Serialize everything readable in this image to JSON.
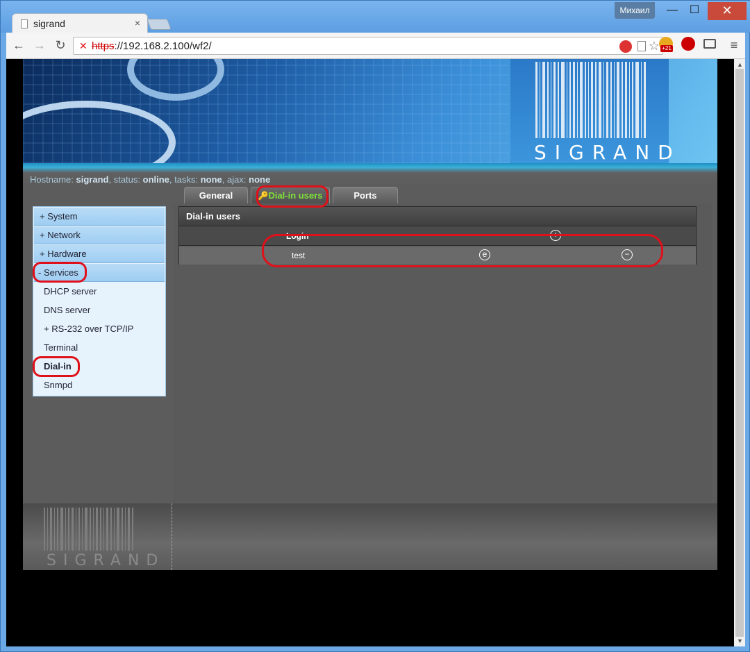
{
  "browser": {
    "tab_title": "sigrand",
    "tab_close": "×",
    "user_name": "Михаил",
    "window_min": "—",
    "window_max": "☐",
    "window_close": "✕",
    "back": "←",
    "forward": "→",
    "reload": "↻",
    "menu": "≡",
    "url_scheme": "https",
    "url_rest": "://192.168.2.100/wf2/",
    "ext_badge": "+21"
  },
  "banner": {
    "brand": "SIGRAND"
  },
  "status": {
    "hostname_label": "Hostname:",
    "hostname": "sigrand",
    "status_label": "status:",
    "status": "online",
    "tasks_label": "tasks:",
    "tasks": "none",
    "ajax_label": "ajax:",
    "ajax": "none"
  },
  "tabs": [
    {
      "label": "General"
    },
    {
      "label": "Dial-in users"
    },
    {
      "label": "Ports"
    }
  ],
  "sidebar": {
    "items": [
      {
        "label": "+ System"
      },
      {
        "label": "+ Network"
      },
      {
        "label": "+ Hardware"
      },
      {
        "label": "- Services"
      },
      {
        "label": "DHCP server"
      },
      {
        "label": "DNS server"
      },
      {
        "label": "+ RS-232 over TCP/IP"
      },
      {
        "label": "Terminal"
      },
      {
        "label": "Dial-in"
      },
      {
        "label": "Snmpd"
      }
    ]
  },
  "panel": {
    "title": "Dial-in users",
    "login_header": "Login",
    "add_symbol": "+",
    "rows": [
      {
        "login": "test",
        "edit_symbol": "e",
        "delete_symbol": "−"
      }
    ]
  },
  "footer": {
    "brand": "SIGRAND"
  },
  "colors": {
    "annotation": "#e0101a",
    "active_tab": "#7fe23a"
  }
}
